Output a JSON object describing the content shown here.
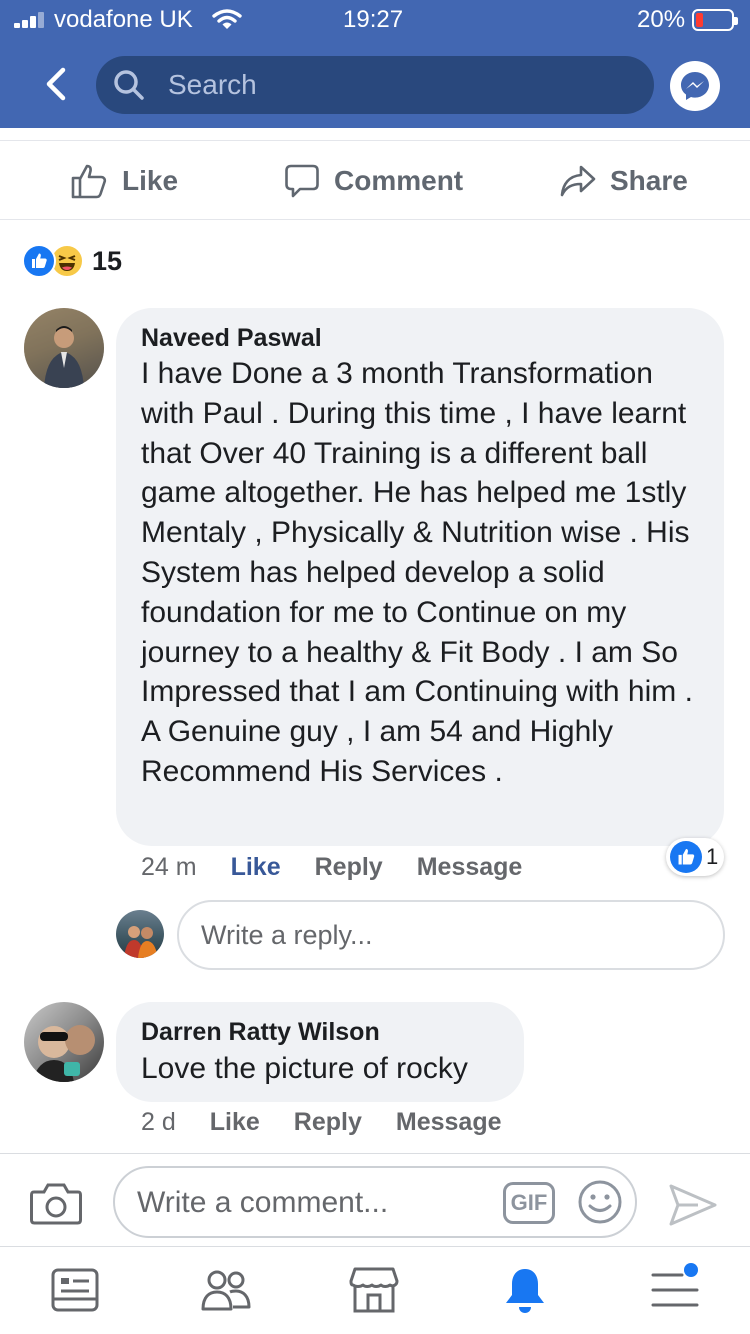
{
  "status_bar": {
    "carrier": "vodafone UK",
    "time": "19:27",
    "battery_percent": "20%"
  },
  "header": {
    "search_placeholder": "Search",
    "icons": [
      "back-arrow-icon",
      "search-icon",
      "messenger-icon"
    ]
  },
  "post_actions": {
    "like_label": "Like",
    "comment_label": "Comment",
    "share_label": "Share"
  },
  "reactions": {
    "types": [
      "like",
      "haha"
    ],
    "count": "15"
  },
  "comments": [
    {
      "author": "Naveed Paswal",
      "text": "I have Done a 3 month Transformation with Paul . During this time ,  I have learnt that Over 40 Training is a different ball game altogether. He has helped me 1stly Mentaly , Physically & Nutrition wise . His System has helped develop a solid foundation for me to Continue on my journey to a healthy & Fit Body . I am So Impressed that I am Continuing with him . A Genuine guy , I am 54  and Highly Recommend His Services .",
      "time": "24 m",
      "like_label": "Like",
      "reply_label": "Reply",
      "message_label": "Message",
      "like_count": "1",
      "liked": true
    },
    {
      "author": "Darren Ratty Wilson",
      "text": "Love the picture of rocky",
      "time": "2 d",
      "like_label": "Like",
      "reply_label": "Reply",
      "message_label": "Message",
      "liked": false
    }
  ],
  "reply_box": {
    "placeholder": "Write a reply..."
  },
  "composer": {
    "placeholder": "Write a comment...",
    "gif_label": "GIF"
  },
  "bottom_nav": {
    "items": [
      "news-feed-icon",
      "friends-icon",
      "marketplace-icon",
      "notifications-icon",
      "menu-icon"
    ],
    "active": "notifications-icon"
  },
  "colors": {
    "brand_blue": "#4267b2",
    "like_blue": "#1877f2",
    "liked_text": "#385898",
    "bubble_gray": "#f0f2f5"
  }
}
